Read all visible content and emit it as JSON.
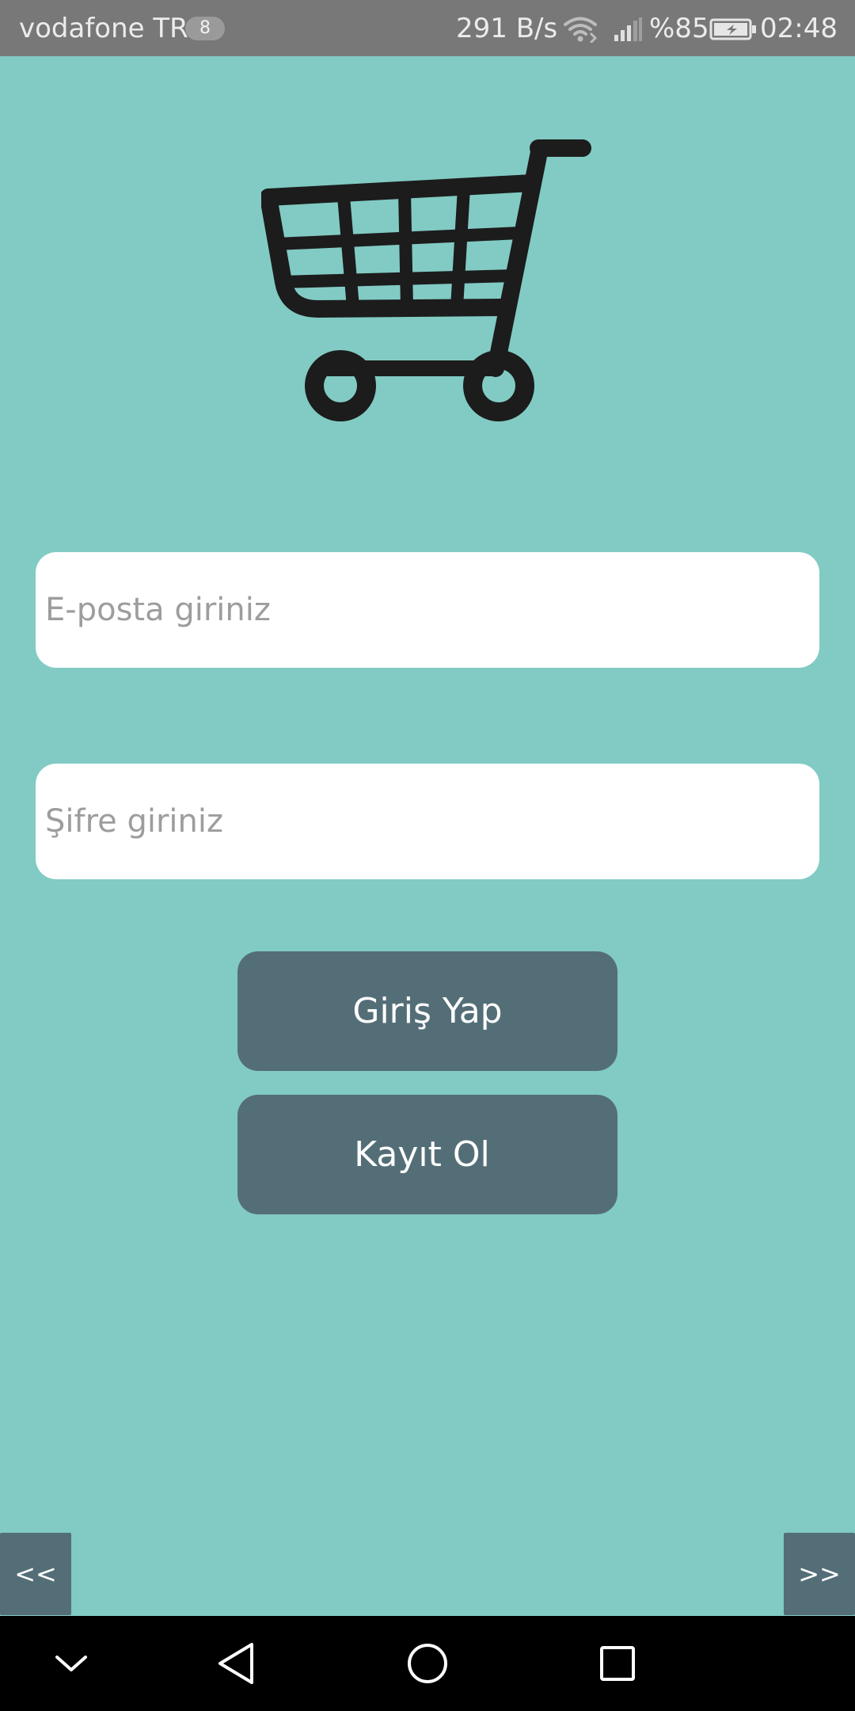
{
  "status_bar": {
    "carrier": "vodafone TR",
    "notification_count": "8",
    "net_speed": "291 B/s",
    "battery_percent": "%85",
    "time": "02:48",
    "icons": [
      "wifi-icon",
      "signal-icon",
      "battery-charging-icon"
    ]
  },
  "logo": {
    "icon": "shopping-cart-icon"
  },
  "login_form": {
    "email_placeholder": "E-posta giriniz",
    "email_value": "",
    "password_placeholder": "Şifre giriniz",
    "password_value": "",
    "login_label": "Giriş Yap",
    "register_label": "Kayıt Ol"
  },
  "pager": {
    "prev_label": "<<",
    "next_label": ">>"
  },
  "system_nav": {
    "icons": [
      "hide-keyboard-icon",
      "back-icon",
      "home-icon",
      "recents-icon"
    ]
  },
  "colors": {
    "background": "#81cbc4",
    "button": "#546e77",
    "status_bar": "#787878",
    "field": "#ffffff",
    "cart": "#1c1c1c"
  }
}
